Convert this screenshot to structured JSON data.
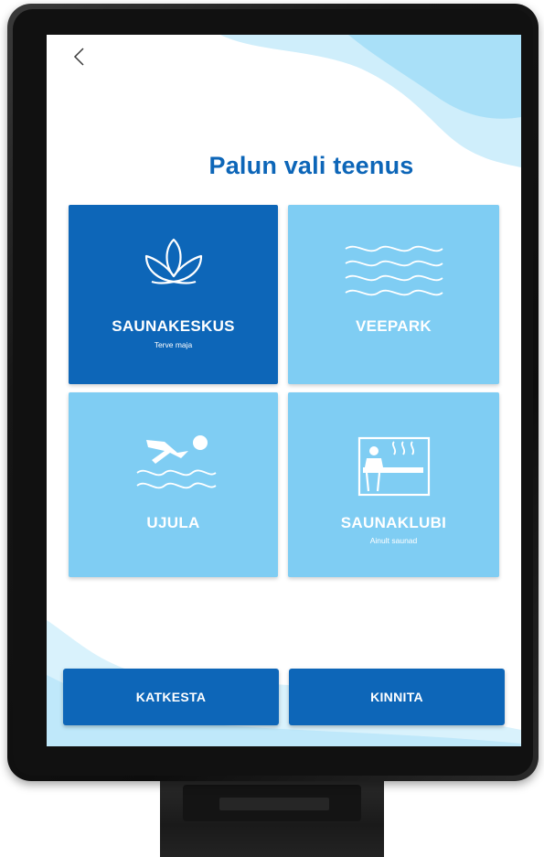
{
  "title": "Palun vali teenus",
  "navigation": {
    "back_icon": "chevron-left-icon"
  },
  "services": [
    {
      "label": "SAUNAKESKUS",
      "subtitle": "Terve maja",
      "icon": "lotus-icon",
      "selected": true
    },
    {
      "label": "VEEPARK",
      "subtitle": "",
      "icon": "waves-icon",
      "selected": false
    },
    {
      "label": "UJULA",
      "subtitle": "",
      "icon": "swimmer-icon",
      "selected": false
    },
    {
      "label": "SAUNAKLUBI",
      "subtitle": "Ainult saunad",
      "icon": "sauna-icon",
      "selected": false
    }
  ],
  "actions": {
    "cancel": "KATKESTA",
    "confirm": "KINNITA"
  },
  "colors": {
    "primary": "#0d66b8",
    "tile_light": "#7fcdf3",
    "wave_light": "#cfeefb"
  }
}
